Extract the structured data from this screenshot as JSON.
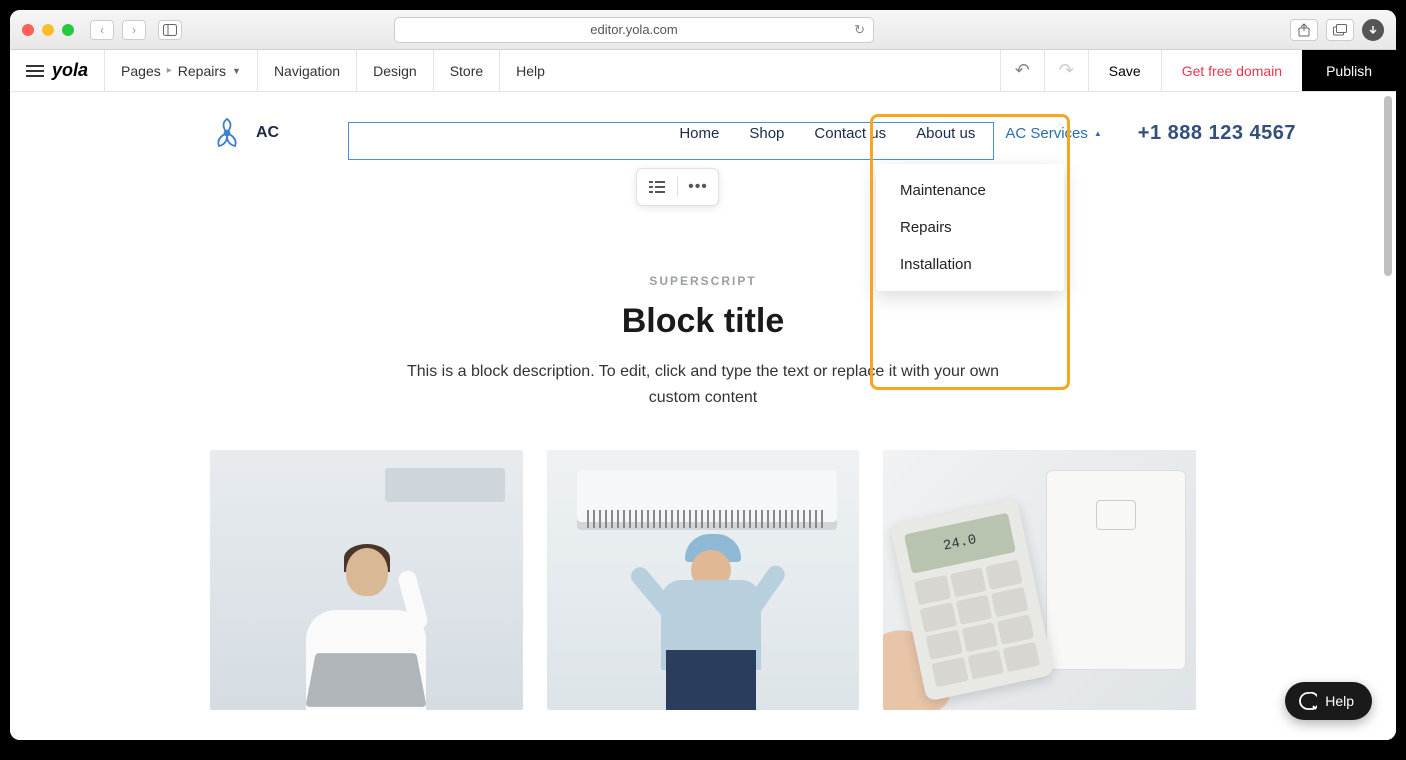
{
  "browser": {
    "url": "editor.yola.com"
  },
  "toolbar": {
    "pages_label": "Pages",
    "current_page": "Repairs",
    "navigation": "Navigation",
    "design": "Design",
    "store": "Store",
    "help": "Help",
    "save": "Save",
    "get_domain": "Get free domain",
    "publish": "Publish"
  },
  "site": {
    "logo_text": "AC",
    "nav": {
      "home": "Home",
      "shop": "Shop",
      "contact": "Contact us",
      "about": "About us",
      "services": "AC Services"
    },
    "phone": "+1 888 123 4567",
    "dropdown": {
      "item1": "Maintenance",
      "item2": "Repairs",
      "item3": "Installation"
    },
    "content": {
      "superscript": "SUPERSCRIPT",
      "title": "Block title",
      "description": "This is a block description. To edit, click and type the text or replace it with your own custom content"
    },
    "remote_display": "24.0"
  },
  "help_bubble": "Help"
}
